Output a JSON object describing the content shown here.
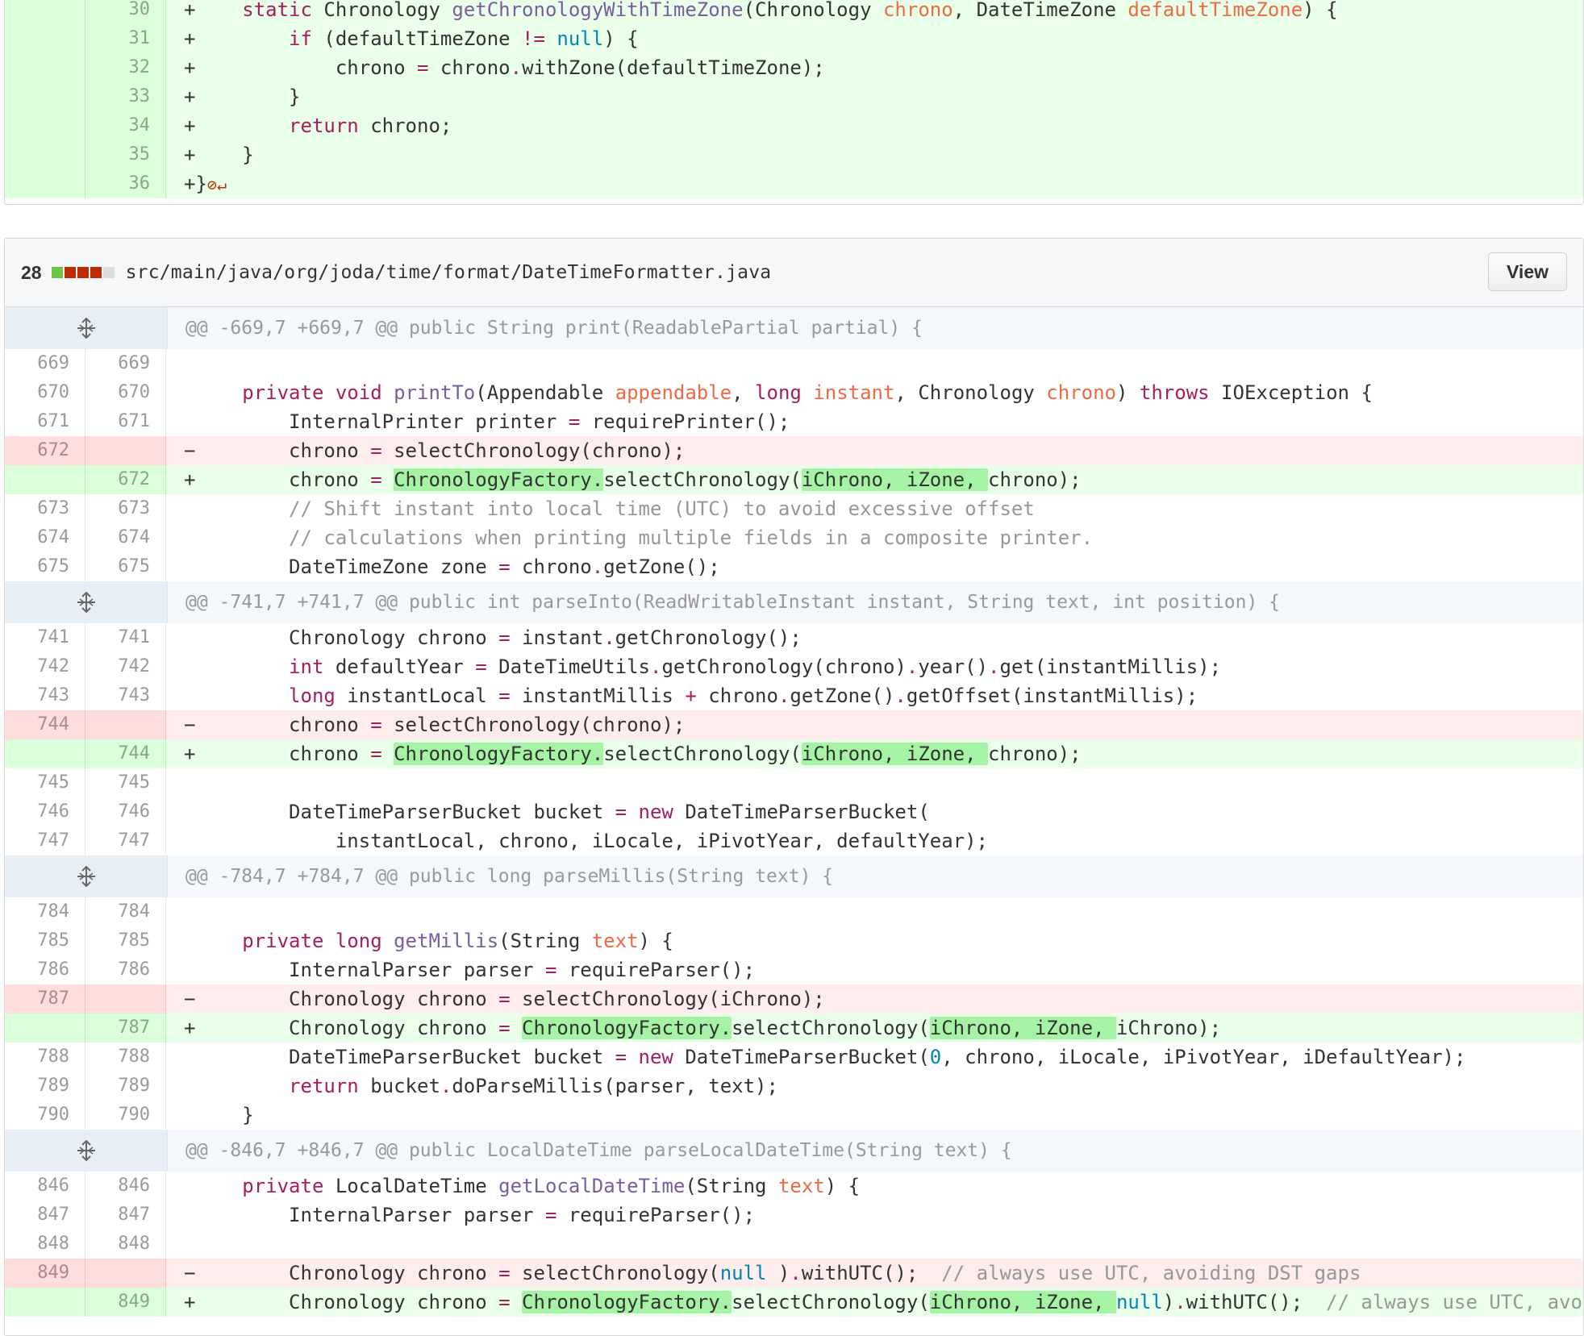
{
  "top_file": {
    "lines": [
      {
        "type": "add",
        "old": "",
        "new": "30",
        "sign": "+",
        "segs": [
          [
            "",
            "    "
          ],
          [
            "kw",
            "static"
          ],
          [
            "",
            " Chronology "
          ],
          [
            "fn",
            "getChronologyWithTimeZone"
          ],
          [
            "",
            "(Chronology "
          ],
          [
            "pr",
            "chrono"
          ],
          [
            "",
            ", DateTimeZone "
          ],
          [
            "pr",
            "defaultTimeZone"
          ],
          [
            "",
            ") {"
          ]
        ]
      },
      {
        "type": "add",
        "old": "",
        "new": "31",
        "sign": "+",
        "segs": [
          [
            "",
            "        "
          ],
          [
            "kw",
            "if"
          ],
          [
            "",
            " (defaultTimeZone "
          ],
          [
            "kw",
            "!="
          ],
          [
            "",
            " "
          ],
          [
            "lit",
            "null"
          ],
          [
            "",
            ") {"
          ]
        ]
      },
      {
        "type": "add",
        "old": "",
        "new": "32",
        "sign": "+",
        "segs": [
          [
            "",
            "            chrono "
          ],
          [
            "kw",
            "="
          ],
          [
            "",
            " chrono"
          ],
          [
            "kw",
            "."
          ],
          [
            "",
            "withZone(defaultTimeZone);"
          ]
        ]
      },
      {
        "type": "add",
        "old": "",
        "new": "33",
        "sign": "+",
        "segs": [
          [
            "",
            "        }"
          ]
        ]
      },
      {
        "type": "add",
        "old": "",
        "new": "34",
        "sign": "+",
        "segs": [
          [
            "",
            "        "
          ],
          [
            "kw",
            "return"
          ],
          [
            "",
            " chrono;"
          ]
        ]
      },
      {
        "type": "add",
        "old": "",
        "new": "35",
        "sign": "+",
        "segs": [
          [
            "",
            "    }"
          ]
        ]
      },
      {
        "type": "add",
        "old": "",
        "new": "36",
        "sign": "+",
        "segs": [
          [
            "",
            "}"
          ]
        ],
        "noeol": "⊘↵"
      }
    ]
  },
  "file": {
    "changes_count": "28",
    "diffstat_colors": [
      "#6cc644",
      "#bd2c00",
      "#bd2c00",
      "#bd2c00",
      "#dddddd"
    ],
    "path": "src/main/java/org/joda/time/format/DateTimeFormatter.java",
    "view_label": "View"
  },
  "lines": [
    {
      "type": "hunk",
      "text": "@@ -669,7 +669,7 @@ public String print(ReadablePartial partial) {"
    },
    {
      "type": "ctx",
      "old": "669",
      "new": "669",
      "sign": "",
      "segs": [
        [
          "",
          ""
        ]
      ]
    },
    {
      "type": "ctx",
      "old": "670",
      "new": "670",
      "sign": "",
      "segs": [
        [
          "",
          "    "
        ],
        [
          "kw",
          "private void"
        ],
        [
          "",
          " "
        ],
        [
          "fn",
          "printTo"
        ],
        [
          "",
          "(Appendable "
        ],
        [
          "pr",
          "appendable"
        ],
        [
          "",
          ", "
        ],
        [
          "kw",
          "long"
        ],
        [
          "",
          " "
        ],
        [
          "pr",
          "instant"
        ],
        [
          "",
          ", Chronology "
        ],
        [
          "pr",
          "chrono"
        ],
        [
          "",
          ") "
        ],
        [
          "kw",
          "throws"
        ],
        [
          "",
          " IOException {"
        ]
      ]
    },
    {
      "type": "ctx",
      "old": "671",
      "new": "671",
      "sign": "",
      "segs": [
        [
          "",
          "        InternalPrinter printer "
        ],
        [
          "kw",
          "="
        ],
        [
          "",
          " requirePrinter();"
        ]
      ]
    },
    {
      "type": "del",
      "old": "672",
      "new": "",
      "sign": "−",
      "segs": [
        [
          "",
          "        chrono "
        ],
        [
          "kw",
          "="
        ],
        [
          "",
          " selectChronology(chrono);"
        ]
      ]
    },
    {
      "type": "add",
      "old": "",
      "new": "672",
      "sign": "+",
      "segs": [
        [
          "",
          "        chrono "
        ],
        [
          "kw",
          "="
        ],
        [
          "",
          " "
        ],
        [
          "hl",
          "ChronologyFactory."
        ],
        [
          "",
          "selectChronology("
        ],
        [
          "hl",
          "iChrono, iZone, "
        ],
        [
          "",
          "chrono);"
        ]
      ]
    },
    {
      "type": "ctx",
      "old": "673",
      "new": "673",
      "sign": "",
      "segs": [
        [
          "",
          "        "
        ],
        [
          "cm",
          "// Shift instant into local time (UTC) to avoid excessive offset"
        ]
      ]
    },
    {
      "type": "ctx",
      "old": "674",
      "new": "674",
      "sign": "",
      "segs": [
        [
          "",
          "        "
        ],
        [
          "cm",
          "// calculations when printing multiple fields in a composite printer."
        ]
      ]
    },
    {
      "type": "ctx",
      "old": "675",
      "new": "675",
      "sign": "",
      "segs": [
        [
          "",
          "        DateTimeZone zone "
        ],
        [
          "kw",
          "="
        ],
        [
          "",
          " chrono"
        ],
        [
          "kw",
          "."
        ],
        [
          "",
          "getZone();"
        ]
      ]
    },
    {
      "type": "hunk",
      "text": "@@ -741,7 +741,7 @@ public int parseInto(ReadWritableInstant instant, String text, int position) {"
    },
    {
      "type": "ctx",
      "old": "741",
      "new": "741",
      "sign": "",
      "segs": [
        [
          "",
          "        Chronology chrono "
        ],
        [
          "kw",
          "="
        ],
        [
          "",
          " instant"
        ],
        [
          "kw",
          "."
        ],
        [
          "",
          "getChronology();"
        ]
      ]
    },
    {
      "type": "ctx",
      "old": "742",
      "new": "742",
      "sign": "",
      "segs": [
        [
          "",
          "        "
        ],
        [
          "kw",
          "int"
        ],
        [
          "",
          " defaultYear "
        ],
        [
          "kw",
          "="
        ],
        [
          "",
          " DateTimeUtils"
        ],
        [
          "kw",
          "."
        ],
        [
          "",
          "getChronology(chrono)"
        ],
        [
          "kw",
          "."
        ],
        [
          "",
          "year()"
        ],
        [
          "kw",
          "."
        ],
        [
          "",
          "get(instantMillis);"
        ]
      ]
    },
    {
      "type": "ctx",
      "old": "743",
      "new": "743",
      "sign": "",
      "segs": [
        [
          "",
          "        "
        ],
        [
          "kw",
          "long"
        ],
        [
          "",
          " instantLocal "
        ],
        [
          "kw",
          "="
        ],
        [
          "",
          " instantMillis "
        ],
        [
          "kw",
          "+"
        ],
        [
          "",
          " chrono"
        ],
        [
          "kw",
          "."
        ],
        [
          "",
          "getZone()"
        ],
        [
          "kw",
          "."
        ],
        [
          "",
          "getOffset(instantMillis);"
        ]
      ]
    },
    {
      "type": "del",
      "old": "744",
      "new": "",
      "sign": "−",
      "segs": [
        [
          "",
          "        chrono "
        ],
        [
          "kw",
          "="
        ],
        [
          "",
          " selectChronology(chrono);"
        ]
      ]
    },
    {
      "type": "add",
      "old": "",
      "new": "744",
      "sign": "+",
      "segs": [
        [
          "",
          "        chrono "
        ],
        [
          "kw",
          "="
        ],
        [
          "",
          " "
        ],
        [
          "hl",
          "ChronologyFactory."
        ],
        [
          "",
          "selectChronology("
        ],
        [
          "hl",
          "iChrono, iZone, "
        ],
        [
          "",
          "chrono);"
        ]
      ]
    },
    {
      "type": "ctx",
      "old": "745",
      "new": "745",
      "sign": "",
      "segs": [
        [
          "",
          ""
        ]
      ]
    },
    {
      "type": "ctx",
      "old": "746",
      "new": "746",
      "sign": "",
      "segs": [
        [
          "",
          "        DateTimeParserBucket bucket "
        ],
        [
          "kw",
          "="
        ],
        [
          "",
          " "
        ],
        [
          "kw",
          "new"
        ],
        [
          "",
          " DateTimeParserBucket("
        ]
      ]
    },
    {
      "type": "ctx",
      "old": "747",
      "new": "747",
      "sign": "",
      "segs": [
        [
          "",
          "            instantLocal, chrono, iLocale, iPivotYear, defaultYear);"
        ]
      ]
    },
    {
      "type": "hunk",
      "text": "@@ -784,7 +784,7 @@ public long parseMillis(String text) {"
    },
    {
      "type": "ctx",
      "old": "784",
      "new": "784",
      "sign": "",
      "segs": [
        [
          "",
          ""
        ]
      ]
    },
    {
      "type": "ctx",
      "old": "785",
      "new": "785",
      "sign": "",
      "segs": [
        [
          "",
          "    "
        ],
        [
          "kw",
          "private long"
        ],
        [
          "",
          " "
        ],
        [
          "fn",
          "getMillis"
        ],
        [
          "",
          "(String "
        ],
        [
          "pr",
          "text"
        ],
        [
          "",
          ") {"
        ]
      ]
    },
    {
      "type": "ctx",
      "old": "786",
      "new": "786",
      "sign": "",
      "segs": [
        [
          "",
          "        InternalParser parser "
        ],
        [
          "kw",
          "="
        ],
        [
          "",
          " requireParser();"
        ]
      ]
    },
    {
      "type": "del",
      "old": "787",
      "new": "",
      "sign": "−",
      "segs": [
        [
          "",
          "        Chronology chrono "
        ],
        [
          "kw",
          "="
        ],
        [
          "",
          " selectChronology(iChrono);"
        ]
      ]
    },
    {
      "type": "add",
      "old": "",
      "new": "787",
      "sign": "+",
      "segs": [
        [
          "",
          "        Chronology chrono "
        ],
        [
          "kw",
          "="
        ],
        [
          "",
          " "
        ],
        [
          "hl",
          "ChronologyFactory."
        ],
        [
          "",
          "selectChronology("
        ],
        [
          "hl",
          "iChrono, iZone, "
        ],
        [
          "",
          "iChrono);"
        ]
      ]
    },
    {
      "type": "ctx",
      "old": "788",
      "new": "788",
      "sign": "",
      "segs": [
        [
          "",
          "        DateTimeParserBucket bucket "
        ],
        [
          "kw",
          "="
        ],
        [
          "",
          " "
        ],
        [
          "kw",
          "new"
        ],
        [
          "",
          " DateTimeParserBucket("
        ],
        [
          "lit",
          "0"
        ],
        [
          "",
          ", chrono, iLocale, iPivotYear, iDefaultYear);"
        ]
      ]
    },
    {
      "type": "ctx",
      "old": "789",
      "new": "789",
      "sign": "",
      "segs": [
        [
          "",
          "        "
        ],
        [
          "kw",
          "return"
        ],
        [
          "",
          " bucket"
        ],
        [
          "kw",
          "."
        ],
        [
          "",
          "doParseMillis(parser, text);"
        ]
      ]
    },
    {
      "type": "ctx",
      "old": "790",
      "new": "790",
      "sign": "",
      "segs": [
        [
          "",
          "    }"
        ]
      ]
    },
    {
      "type": "hunk",
      "text": "@@ -846,7 +846,7 @@ public LocalDateTime parseLocalDateTime(String text) {"
    },
    {
      "type": "ctx",
      "old": "846",
      "new": "846",
      "sign": "",
      "segs": [
        [
          "",
          "    "
        ],
        [
          "kw",
          "private"
        ],
        [
          "",
          " LocalDateTime "
        ],
        [
          "fn",
          "getLocalDateTime"
        ],
        [
          "",
          "(String "
        ],
        [
          "pr",
          "text"
        ],
        [
          "",
          ") {"
        ]
      ]
    },
    {
      "type": "ctx",
      "old": "847",
      "new": "847",
      "sign": "",
      "segs": [
        [
          "",
          "        InternalParser parser "
        ],
        [
          "kw",
          "="
        ],
        [
          "",
          " requireParser();"
        ]
      ]
    },
    {
      "type": "ctx",
      "old": "848",
      "new": "848",
      "sign": "",
      "segs": [
        [
          "",
          ""
        ]
      ]
    },
    {
      "type": "del",
      "old": "849",
      "new": "",
      "sign": "−",
      "segs": [
        [
          "",
          "        Chronology chrono "
        ],
        [
          "kw",
          "="
        ],
        [
          "",
          " selectChronology("
        ],
        [
          "lit",
          "null"
        ],
        [
          "",
          " )"
        ],
        [
          "kw",
          "."
        ],
        [
          "",
          "withUTC();  "
        ],
        [
          "cm",
          "// always use UTC, avoiding DST gaps"
        ]
      ]
    },
    {
      "type": "add",
      "old": "",
      "new": "849",
      "sign": "+",
      "segs": [
        [
          "",
          "        Chronology chrono "
        ],
        [
          "kw",
          "="
        ],
        [
          "",
          " "
        ],
        [
          "hl",
          "ChronologyFactory."
        ],
        [
          "",
          "selectChronology("
        ],
        [
          "hl",
          "iChrono, iZone, "
        ],
        [
          "lit",
          "null"
        ],
        [
          "",
          ")"
        ],
        [
          "kw",
          "."
        ],
        [
          "",
          "withUTC();  "
        ],
        [
          "cm",
          "// always use UTC, avo"
        ]
      ]
    }
  ]
}
